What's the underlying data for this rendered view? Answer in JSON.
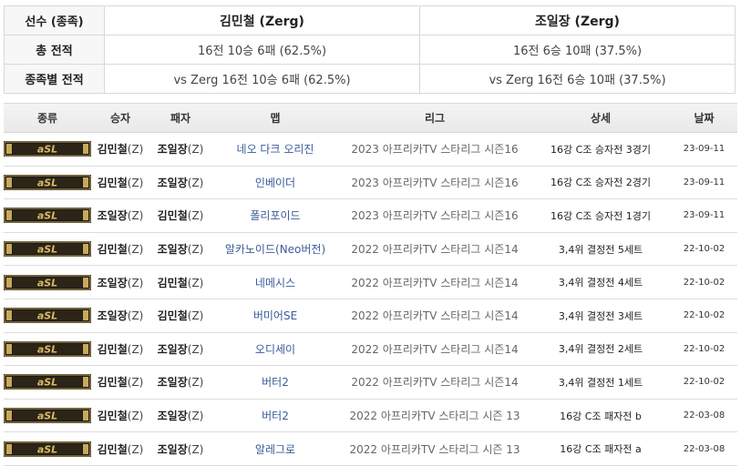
{
  "summary": {
    "player_header": "선수 (종족)",
    "player1": "김민철 (Zerg)",
    "player2": "조일장 (Zerg)",
    "total_label": "총 전적",
    "total_p1": "16전 10승 6패 (62.5%)",
    "total_p2": "16전 6승 10패 (37.5%)",
    "race_label": "종족별 전적",
    "race_p1": "vs Zerg 16전 10승 6패 (62.5%)",
    "race_p2": "vs Zerg 16전 6승 10패 (37.5%)"
  },
  "columns": {
    "type": "종류",
    "winner": "승자",
    "loser": "패자",
    "map": "맵",
    "league": "리그",
    "detail": "상세",
    "date": "날짜"
  },
  "logo": {
    "text": "aSL",
    "colors": {
      "gold": "#c8a95a",
      "dark": "#1a1a1a"
    }
  },
  "colors": {
    "map_link": "#3a5b9a"
  },
  "matches": [
    {
      "winner": "김민철",
      "winner_race": "(Z)",
      "loser": "조일장",
      "loser_race": "(Z)",
      "map": "네오 다크 오리진",
      "league": "2023 아프리카TV 스타리그 시즌16",
      "detail": "16강 C조 승자전 3경기",
      "date": "23-09-11"
    },
    {
      "winner": "김민철",
      "winner_race": "(Z)",
      "loser": "조일장",
      "loser_race": "(Z)",
      "map": "인베이더",
      "league": "2023 아프리카TV 스타리그 시즌16",
      "detail": "16강 C조 승자전 2경기",
      "date": "23-09-11"
    },
    {
      "winner": "조일장",
      "winner_race": "(Z)",
      "loser": "김민철",
      "loser_race": "(Z)",
      "map": "폴리포이드",
      "league": "2023 아프리카TV 스타리그 시즌16",
      "detail": "16강 C조 승자전 1경기",
      "date": "23-09-11"
    },
    {
      "winner": "김민철",
      "winner_race": "(Z)",
      "loser": "조일장",
      "loser_race": "(Z)",
      "map": "알카노이드(Neo버전)",
      "league": "2022 아프리카TV 스타리그 시즌14",
      "detail": "3,4위 결정전 5세트",
      "date": "22-10-02"
    },
    {
      "winner": "조일장",
      "winner_race": "(Z)",
      "loser": "김민철",
      "loser_race": "(Z)",
      "map": "네메시스",
      "league": "2022 아프리카TV 스타리그 시즌14",
      "detail": "3,4위 결정전 4세트",
      "date": "22-10-02"
    },
    {
      "winner": "조일장",
      "winner_race": "(Z)",
      "loser": "김민철",
      "loser_race": "(Z)",
      "map": "버미어SE",
      "league": "2022 아프리카TV 스타리그 시즌14",
      "detail": "3,4위 결정전 3세트",
      "date": "22-10-02"
    },
    {
      "winner": "김민철",
      "winner_race": "(Z)",
      "loser": "조일장",
      "loser_race": "(Z)",
      "map": "오디세이",
      "league": "2022 아프리카TV 스타리그 시즌14",
      "detail": "3,4위 결정전 2세트",
      "date": "22-10-02"
    },
    {
      "winner": "김민철",
      "winner_race": "(Z)",
      "loser": "조일장",
      "loser_race": "(Z)",
      "map": "버터2",
      "league": "2022 아프리카TV 스타리그 시즌14",
      "detail": "3,4위 결정전 1세트",
      "date": "22-10-02"
    },
    {
      "winner": "김민철",
      "winner_race": "(Z)",
      "loser": "조일장",
      "loser_race": "(Z)",
      "map": "버터2",
      "league": "2022 아프리카TV 스타리그 시즌 13",
      "detail": "16강 C조 패자전 b",
      "date": "22-03-08"
    },
    {
      "winner": "김민철",
      "winner_race": "(Z)",
      "loser": "조일장",
      "loser_race": "(Z)",
      "map": "알레그로",
      "league": "2022 아프리카TV 스타리그 시즌 13",
      "detail": "16강 C조 패자전 a",
      "date": "22-03-08"
    }
  ]
}
